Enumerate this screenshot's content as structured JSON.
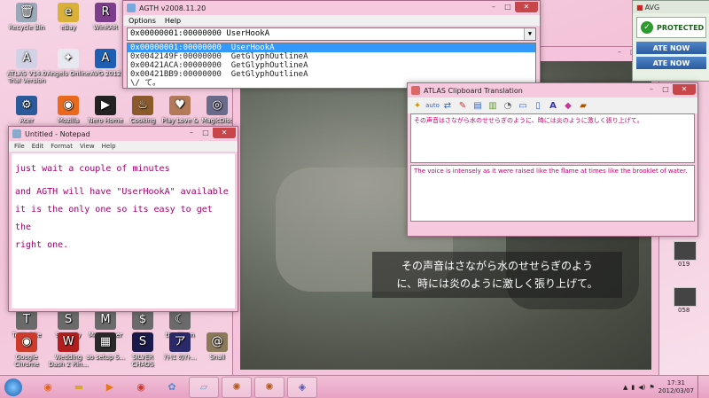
{
  "desktop_icons": [
    {
      "label": "Recycle Bin",
      "color": "#9aa8b8",
      "glyph": "🗑"
    },
    {
      "label": "eBay",
      "color": "#d9b13a",
      "glyph": "e"
    },
    {
      "label": "WinRAR",
      "color": "#7d3d8d",
      "glyph": "R"
    },
    {
      "label": "ATLAS V14.0 Trial Version",
      "color": "#d2d2e6",
      "glyph": "A"
    },
    {
      "label": "Angels Online",
      "color": "#e8e8f0",
      "glyph": "✦"
    },
    {
      "label": "AVG 2012",
      "color": "#1f5fb3",
      "glyph": "A"
    },
    {
      "label": "Acer",
      "color": "#2a5a9a",
      "glyph": "⚙"
    },
    {
      "label": "Mozilla",
      "color": "#e96a1c",
      "glyph": "◉"
    },
    {
      "label": "Nero Home",
      "color": "#222222",
      "glyph": "▶"
    },
    {
      "label": "Cooking",
      "color": "#8a5a2a",
      "glyph": "♨"
    },
    {
      "label": "Play Love &",
      "color": "#b37a5a",
      "glyph": "♥"
    },
    {
      "label": "MagicDisc",
      "color": "#6a6a8a",
      "glyph": "◎"
    },
    {
      "label": "Tools Site",
      "color": "#6a6a6a",
      "glyph": "T"
    },
    {
      "label": "Security",
      "color": "#6a6a6a",
      "glyph": "S"
    },
    {
      "label": "Messenger",
      "color": "#6a6a6a",
      "glyph": "M"
    },
    {
      "label": "Cash",
      "color": "#6a6a6a",
      "glyph": "$"
    },
    {
      "label": "the Moon",
      "color": "#6a6a6a",
      "glyph": "☾"
    },
    {
      "label": "Google Chrome",
      "color": "#cc3b2c",
      "glyph": "◉"
    },
    {
      "label": "Wedding Dash 2 Rin...",
      "color": "#b11e1e",
      "glyph": "W"
    },
    {
      "label": "ao setup S...",
      "color": "#2a2a2a",
      "glyph": "▦"
    },
    {
      "label": "SILVER CHAOS",
      "color": "#1a1a4a",
      "glyph": "S"
    },
    {
      "label": "ｱﾄﾘｴ のｱﾄ...",
      "color": "#2a2a6a",
      "glyph": "ア"
    },
    {
      "label": "Snail",
      "color": "#8a7a5a",
      "glyph": "@"
    }
  ],
  "avg": {
    "brand": "AVG",
    "status": "PROTECTED",
    "btn1": "ATE NOW",
    "btn2": "ATE NOW"
  },
  "agth": {
    "title": "AGTH v2008.11.20",
    "menu": [
      "Options",
      "Help"
    ],
    "combo": "0x00000001:00000000  UserHookA",
    "items": [
      "0x00000001:00000000  UserHookA",
      "0x0042149F:00000000  GetGlyphOutlineA",
      "0x00421ACA:00000000  GetGlyphOutlineA",
      "0x00421BB9:00000000  GetGlyphOutlineA",
      "\\/ て。"
    ]
  },
  "notepad": {
    "title": "Untitled - Notepad",
    "menu": [
      "File",
      "Edit",
      "Format",
      "View",
      "Help"
    ],
    "lines": [
      "just wait a couple of minutes",
      "and AGTH will have \"UserHookA\" available",
      "it is the only one so its easy to get the",
      "right one."
    ]
  },
  "atlas": {
    "title": "ATLAS Clipboard Translation",
    "source": "その声音はさながら水のせせらぎのように、時には炎のように激しく張り上げて。",
    "translation": "The voice is intensely as it were raised like the flame at times like the brooklet of water."
  },
  "game": {
    "subtitle_line1": "その声音はさながら水のせせらぎのよう",
    "subtitle_line2": "に、時には炎のように激しく張り上げて。"
  },
  "side": {
    "lbl1": "019",
    "lbl2": "058"
  },
  "taskbar": {
    "time": "17:31",
    "date": "2012/03/07",
    "buttons": [
      "firefox",
      "explorer",
      "media",
      "chrome",
      "paint",
      "notepad",
      "game1",
      "game2",
      "atlas"
    ]
  }
}
